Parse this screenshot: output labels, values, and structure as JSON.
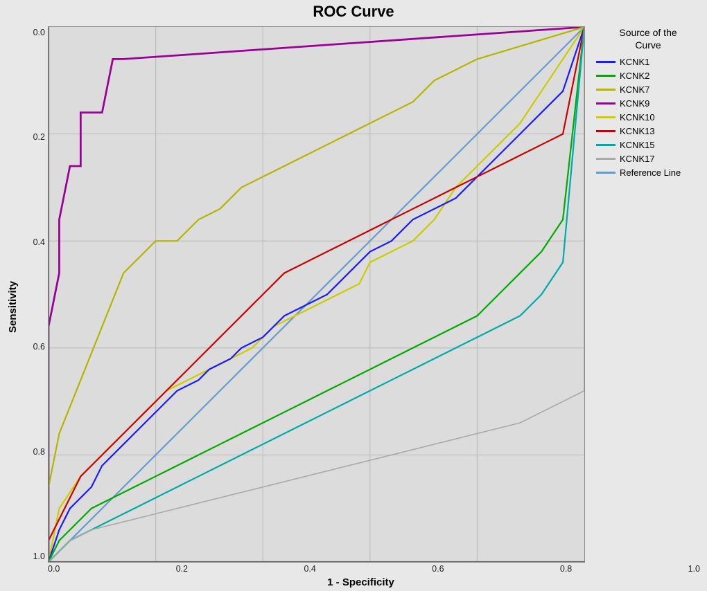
{
  "title": "ROC Curve",
  "xLabel": "1 - Specificity",
  "yLabel": "Sensitivity",
  "xTicks": [
    "0.0",
    "0.2",
    "0.4",
    "0.6",
    "0.8",
    "1.0"
  ],
  "yTicks": [
    "0.0",
    "0.2",
    "0.4",
    "0.6",
    "0.8",
    "1.0"
  ],
  "legend": {
    "title": "Source of the\nCurve",
    "items": [
      {
        "label": "KCNK1",
        "color": "#1a1aff"
      },
      {
        "label": "KCNK2",
        "color": "#00aa00"
      },
      {
        "label": "KCNK7",
        "color": "#b5b500"
      },
      {
        "label": "KCNK9",
        "color": "#990099"
      },
      {
        "label": "KCNK10",
        "color": "#cccc00"
      },
      {
        "label": "KCNK13",
        "color": "#cc0000"
      },
      {
        "label": "KCNK15",
        "color": "#00aaaa"
      },
      {
        "label": "KCNK17",
        "color": "#aaaaaa"
      },
      {
        "label": "Reference Line",
        "color": "#6699cc"
      }
    ]
  }
}
